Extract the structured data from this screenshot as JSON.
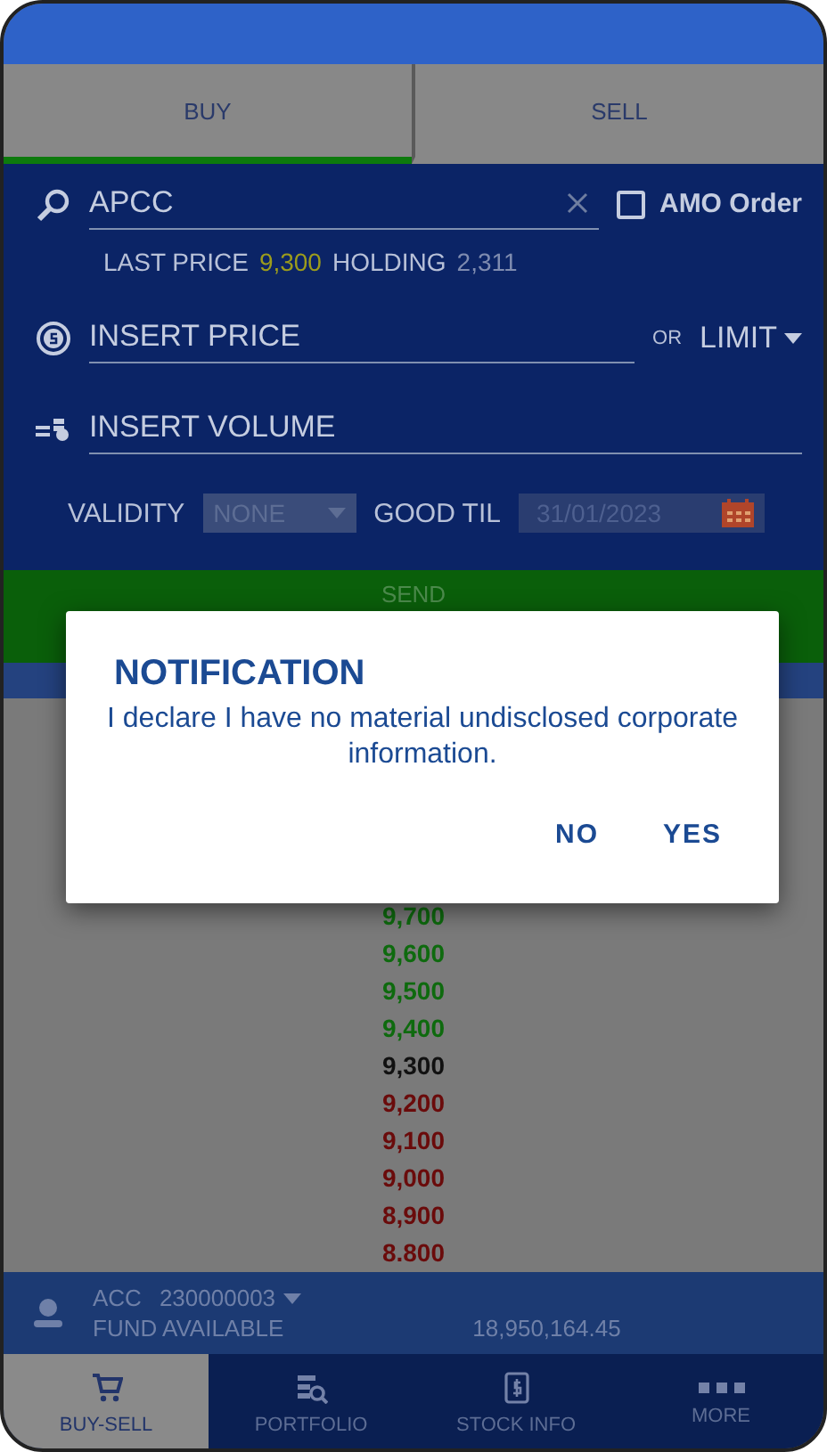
{
  "tabs": [
    {
      "label": "BUY",
      "selected": true
    },
    {
      "label": "SELL",
      "selected": false
    }
  ],
  "order_form": {
    "symbol": {
      "value": "APCC"
    },
    "amo_order": {
      "label": "AMO Order",
      "checked": false
    },
    "last_price_label": "LAST PRICE",
    "last_price": "9,300",
    "holding_label": "HOLDING",
    "holding": "2,311",
    "price": {
      "placeholder": "INSERT PRICE"
    },
    "or_label": "OR",
    "order_type": "LIMIT",
    "volume": {
      "placeholder": "INSERT VOLUME"
    },
    "validity_label": "VALIDITY",
    "validity": "NONE",
    "good_til_label": "GOOD TIL",
    "good_til": "31/01/2023"
  },
  "send_button": "SEND",
  "price_ladder": [
    {
      "price": "9,700",
      "color": "#0e6a0e"
    },
    {
      "price": "9,600",
      "color": "#0e6a0e"
    },
    {
      "price": "9,500",
      "color": "#0e6a0e"
    },
    {
      "price": "9,400",
      "color": "#0e6a0e"
    },
    {
      "price": "9,300",
      "color": "#111111"
    },
    {
      "price": "9,200",
      "color": "#6a0b0b"
    },
    {
      "price": "9,100",
      "color": "#6a0b0b"
    },
    {
      "price": "9,000",
      "color": "#6a0b0b"
    },
    {
      "price": "8,900",
      "color": "#6a0b0b"
    },
    {
      "price": "8.800",
      "color": "#6a0b0b"
    }
  ],
  "account": {
    "label": "ACC",
    "number": "230000003",
    "fund_label": "FUND AVAILABLE",
    "fund": "18,950,164.45"
  },
  "dialog": {
    "title": "NOTIFICATION",
    "message": "I declare I have no material undisclosed corporate information.",
    "buttons": [
      "NO",
      "YES"
    ]
  },
  "bottom_nav": [
    {
      "label": "BUY-SELL",
      "kind": "cart",
      "selected": true
    },
    {
      "label": "PORTFOLIO",
      "kind": "portfolio",
      "selected": false
    },
    {
      "label": "STOCK INFO",
      "kind": "info",
      "selected": false
    },
    {
      "label": "MORE",
      "kind": "more",
      "selected": false
    }
  ]
}
